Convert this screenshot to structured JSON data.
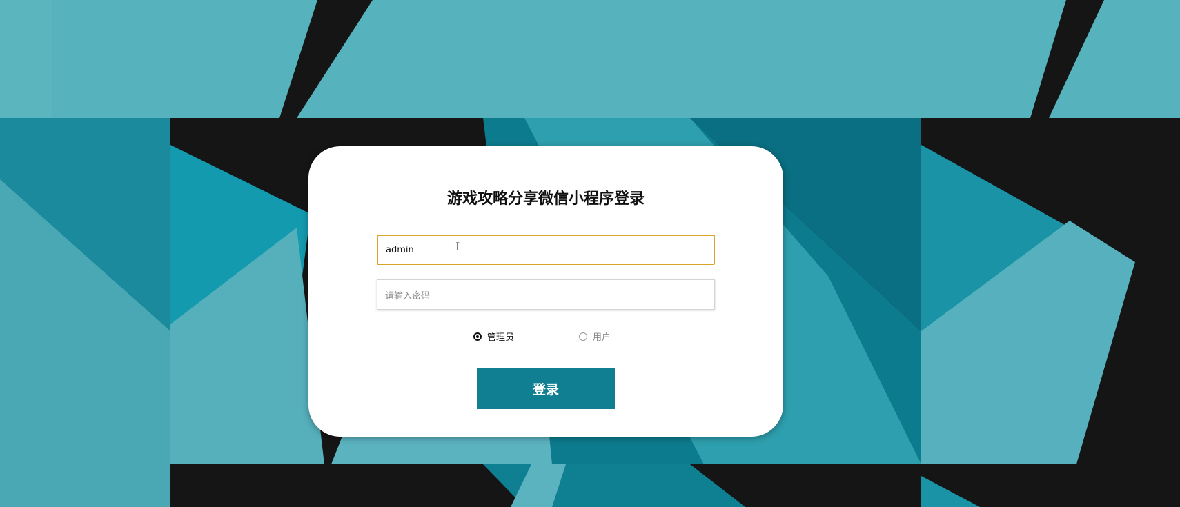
{
  "page": {
    "title": "游戏攻略分享微信小程序登录"
  },
  "form": {
    "username_value": "admin",
    "password_placeholder": "请输入密码",
    "roles": [
      {
        "label": "管理员",
        "checked": true
      },
      {
        "label": "用户",
        "checked": false
      }
    ],
    "login_label": "登录"
  },
  "colors": {
    "accent": "#117f92",
    "focus_border": "#d8a52a",
    "background_teal": "#56b2bd"
  },
  "icons": {
    "cursor": "text-cursor-icon"
  }
}
